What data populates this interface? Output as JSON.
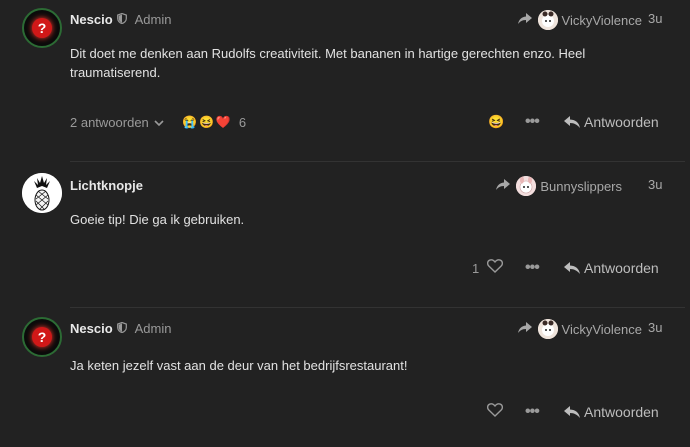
{
  "posts": [
    {
      "username": "Nescio",
      "role": "Admin",
      "reply_to": "VickyViolence",
      "age": "3u",
      "content": "Dit doet me denken aan Rudolfs creativiteit. Met bananen in hartige gerechten enzo. Heel traumatiserend.",
      "replies_label": "2 antwoorden",
      "reactions": [
        "😭",
        "😆",
        "❤️"
      ],
      "reaction_count": "6",
      "reply_label": "Antwoorden"
    },
    {
      "username": "Lichtknopje",
      "reply_to": "Bunnyslippers",
      "age": "3u",
      "content": "Goeie tip! Die ga ik gebruiken.",
      "like_count": "1",
      "reply_label": "Antwoorden"
    },
    {
      "username": "Nescio",
      "role": "Admin",
      "reply_to": "VickyViolence",
      "age": "3u",
      "content": "Ja keten jezelf vast aan de deur van het bedrijfsrestaurant!",
      "reply_label": "Antwoorden"
    }
  ]
}
